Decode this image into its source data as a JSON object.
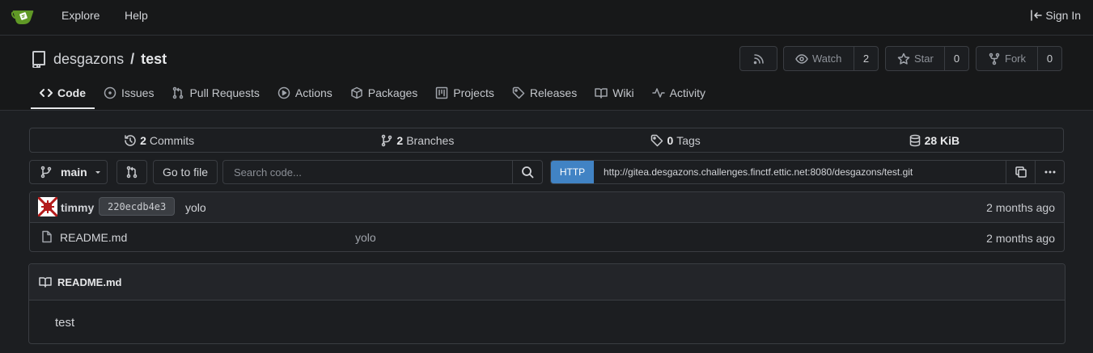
{
  "nav": {
    "explore": "Explore",
    "help": "Help",
    "sign_in": "Sign In"
  },
  "repo": {
    "owner": "desgazons",
    "separator": "/",
    "name": "test",
    "watch_label": "Watch",
    "watch_count": "2",
    "star_label": "Star",
    "star_count": "0",
    "fork_label": "Fork",
    "fork_count": "0"
  },
  "tabs": [
    {
      "label": "Code",
      "icon": "code-icon",
      "active": true
    },
    {
      "label": "Issues",
      "icon": "issue-icon"
    },
    {
      "label": "Pull Requests",
      "icon": "pull-request-icon"
    },
    {
      "label": "Actions",
      "icon": "play-icon"
    },
    {
      "label": "Packages",
      "icon": "package-icon"
    },
    {
      "label": "Projects",
      "icon": "project-icon"
    },
    {
      "label": "Releases",
      "icon": "tag-icon"
    },
    {
      "label": "Wiki",
      "icon": "book-icon"
    },
    {
      "label": "Activity",
      "icon": "pulse-icon"
    }
  ],
  "stats": {
    "commits_count": "2",
    "commits_label": "Commits",
    "branches_count": "2",
    "branches_label": "Branches",
    "tags_count": "0",
    "tags_label": "Tags",
    "size_value": "28 KiB"
  },
  "toolbar": {
    "branch": "main",
    "go_to_file": "Go to file",
    "search_placeholder": "Search code...",
    "clone_protocol": "HTTP",
    "clone_url": "http://gitea.desgazons.challenges.finctf.ettic.net:8080/desgazons/test.git"
  },
  "latest_commit": {
    "author": "timmy",
    "sha": "220ecdb4e3",
    "message": "yolo",
    "time": "2 months ago"
  },
  "files": [
    {
      "name": "README.md",
      "message": "yolo",
      "time": "2 months ago"
    }
  ],
  "readme": {
    "title": "README.md",
    "content": "test"
  },
  "colors": {
    "background": "#1c1e21",
    "header": "#171819",
    "accent_http": "#4183c4",
    "logo_green": "#609926"
  }
}
